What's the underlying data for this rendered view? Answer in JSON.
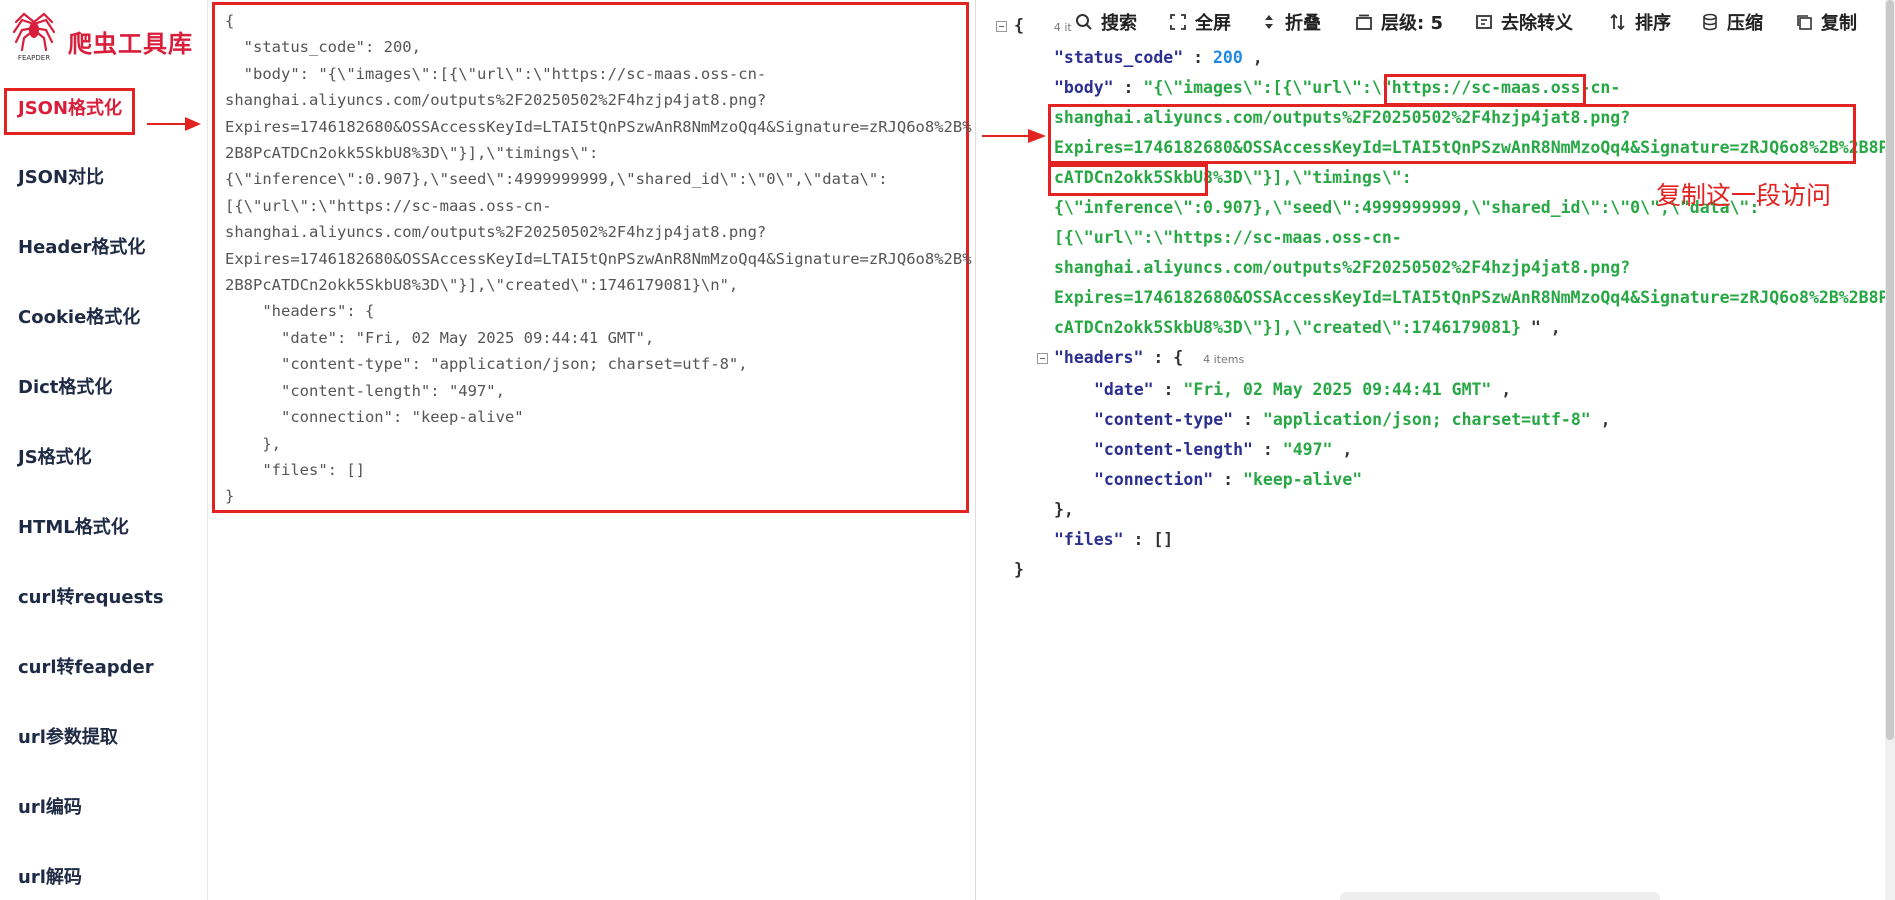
{
  "brand": {
    "name": "爬虫工具库",
    "logo_text": "FEAPDER",
    "logo_icon": "spider-icon"
  },
  "nav": {
    "items": [
      {
        "label": "JSON格式化",
        "active": true
      },
      {
        "label": "JSON对比"
      },
      {
        "label": "Header格式化"
      },
      {
        "label": "Cookie格式化"
      },
      {
        "label": "Dict格式化"
      },
      {
        "label": "JS格式化"
      },
      {
        "label": "HTML格式化"
      },
      {
        "label": "curl转requests"
      },
      {
        "label": "curl转feapder"
      },
      {
        "label": "url参数提取"
      },
      {
        "label": "url编码"
      },
      {
        "label": "url解码"
      }
    ]
  },
  "editor": {
    "lines": [
      "{",
      "  \"status_code\": 200,",
      "  \"body\": \"{\\\"images\\\":[{\\\"url\\\":\\\"https://sc-maas.oss-cn-",
      "shanghai.aliyuncs.com/outputs%2F20250502%2F4hzjp4jat8.png?",
      "Expires=1746182680&OSSAccessKeyId=LTAI5tQnPSzwAnR8NmMzoQq4&Signature=zRJQ6o8%2B%",
      "2B8PcATDCn2okk5SkbU8%3D\\\"}],\\\"timings\\\":",
      "{\\\"inference\\\":0.907},\\\"seed\\\":4999999999,\\\"shared_id\\\":\\\"0\\\",\\\"data\\\":",
      "[{\\\"url\\\":\\\"https://sc-maas.oss-cn-",
      "shanghai.aliyuncs.com/outputs%2F20250502%2F4hzjp4jat8.png?",
      "Expires=1746182680&OSSAccessKeyId=LTAI5tQnPSzwAnR8NmMzoQq4&Signature=zRJQ6o8%2B%",
      "2B8PcATDCn2okk5SkbU8%3D\\\"}],\\\"created\\\":1746179081}\\n\",",
      "    \"headers\": {",
      "      \"date\": \"Fri, 02 May 2025 09:44:41 GMT\",",
      "      \"content-type\": \"application/json; charset=utf-8\",",
      "      \"content-length\": \"497\",",
      "      \"connection\": \"keep-alive\"",
      "    },",
      "    \"files\": []",
      "}"
    ]
  },
  "toolbar": {
    "search": "搜索",
    "fullscreen": "全屏",
    "fold": "折叠",
    "level": "层级: 5",
    "unescape": "去除转义",
    "sort": "排序",
    "compress": "压缩",
    "copy": "复制"
  },
  "viewer": {
    "root_open": "{",
    "root_close": "}",
    "root_count": "4 it",
    "status_code_key": "\"status_code\"",
    "status_code_val": "200",
    "body_key": "\"body\"",
    "body_l1_prefix": "\"{\\\"images\\\":[{\\\"url\\\":\\\"",
    "body_l1_url": "https://sc-maas.oss-cn-",
    "body_l2": "shanghai.aliyuncs.com/outputs%2F20250502%2F4hzjp4jat8.png?",
    "body_l3": "Expires=1746182680&OSSAccessKeyId=LTAI5tQnPSzwAnR8NmMzoQq4&Signature=zRJQ6o8%2B%2B8P",
    "body_l4_url": "cATDCn2okk5SkbU8%3D",
    "body_l4_rest": "\\\"}],\\\"timings\\\":",
    "body_l5": "{\\\"inference\\\":0.907},\\\"seed\\\":4999999999,\\\"shared_id\\\":\\\"0\\\",\\\"data\\\":",
    "body_l6": "[{\\\"url\\\":\\\"https://sc-maas.oss-cn-",
    "body_l7": "shanghai.aliyuncs.com/outputs%2F20250502%2F4hzjp4jat8.png?",
    "body_l8": "Expires=1746182680&OSSAccessKeyId=LTAI5tQnPSzwAnR8NmMzoQq4&Signature=zRJQ6o8%2B%2B8P",
    "body_l9": "cATDCn2okk5SkbU8%3D\\\"}],\\\"created\\\":1746179081}",
    "body_l9_tail": " \" ,",
    "headers_key": "\"headers\"",
    "headers_count": "4 items",
    "date_key": "\"date\"",
    "date_val": "\"Fri, 02 May 2025 09:44:41 GMT\"",
    "ct_key": "\"content-type\"",
    "ct_val": "\"application/json; charset=utf-8\"",
    "cl_key": "\"content-length\"",
    "cl_val": "\"497\"",
    "conn_key": "\"connection\"",
    "conn_val": "\"keep-alive\"",
    "files_key": "\"files\"",
    "files_val": "[]"
  },
  "annotation": {
    "text": "复制这一段访问",
    "color": "#e32222"
  },
  "colors": {
    "brand": "#d81e3a",
    "highlight": "#e32222",
    "string": "#28a745",
    "number": "#1e88e5",
    "key": "#2b2f8f"
  }
}
